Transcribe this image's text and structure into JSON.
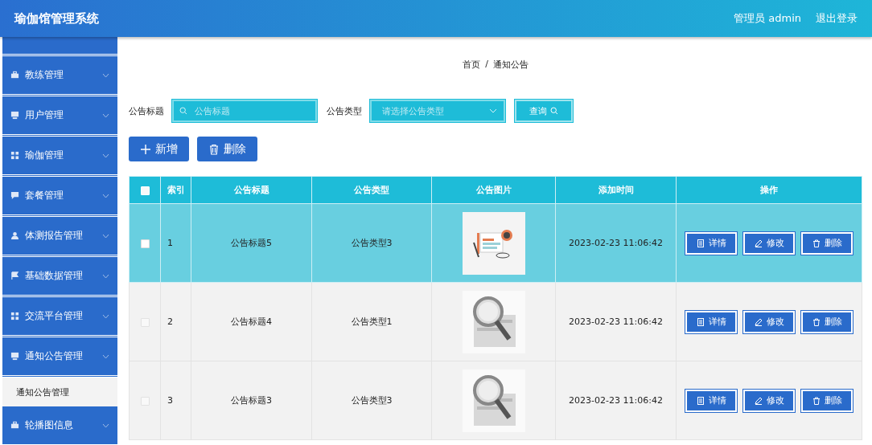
{
  "header": {
    "title": "瑜伽馆管理系统",
    "user": "管理员 admin",
    "logout": "退出登录"
  },
  "sidebar": {
    "items": [
      {
        "kind": "cut"
      },
      {
        "label": "教练管理"
      },
      {
        "label": "用户管理"
      },
      {
        "label": "瑜伽管理"
      },
      {
        "label": "套餐管理"
      },
      {
        "label": "体测报告管理"
      },
      {
        "label": "基础数据管理"
      },
      {
        "label": "交流平台管理"
      },
      {
        "label": "通知公告管理",
        "children": [
          {
            "label": "通知公告管理"
          }
        ]
      },
      {
        "label": "轮播图信息"
      }
    ]
  },
  "breadcrumb": [
    "首页",
    "/",
    "通知公告"
  ],
  "search": {
    "title_label": "公告标题",
    "title_placeholder": "公告标题",
    "type_label": "公告类型",
    "type_placeholder": "请选择公告类型",
    "query_button": "查询"
  },
  "actions": [
    "新增",
    "删除"
  ],
  "table": {
    "all_checked": false,
    "columns": [
      "索引",
      "公告标题",
      "公告类型",
      "公告图片",
      "添加时间",
      "操作"
    ],
    "rows": [
      {
        "selected": true,
        "checked": false,
        "index": "1",
        "title": "公告标题5",
        "type": "公告类型3",
        "time": "2023-02-23 11:06:42",
        "buttons": [
          "详情",
          "修改",
          "删除"
        ]
      },
      {
        "selected": false,
        "checked": false,
        "index": "2",
        "title": "公告标题4",
        "type": "公告类型1",
        "time": "2023-02-23 11:06:42",
        "buttons": [
          "详情",
          "修改",
          "删除"
        ]
      },
      {
        "selected": false,
        "checked": false,
        "index": "3",
        "title": "公告标题3",
        "type": "公告类型3",
        "time": "2023-02-23 11:06:42",
        "buttons": [
          "详情",
          "修改",
          "删除"
        ]
      }
    ]
  }
}
